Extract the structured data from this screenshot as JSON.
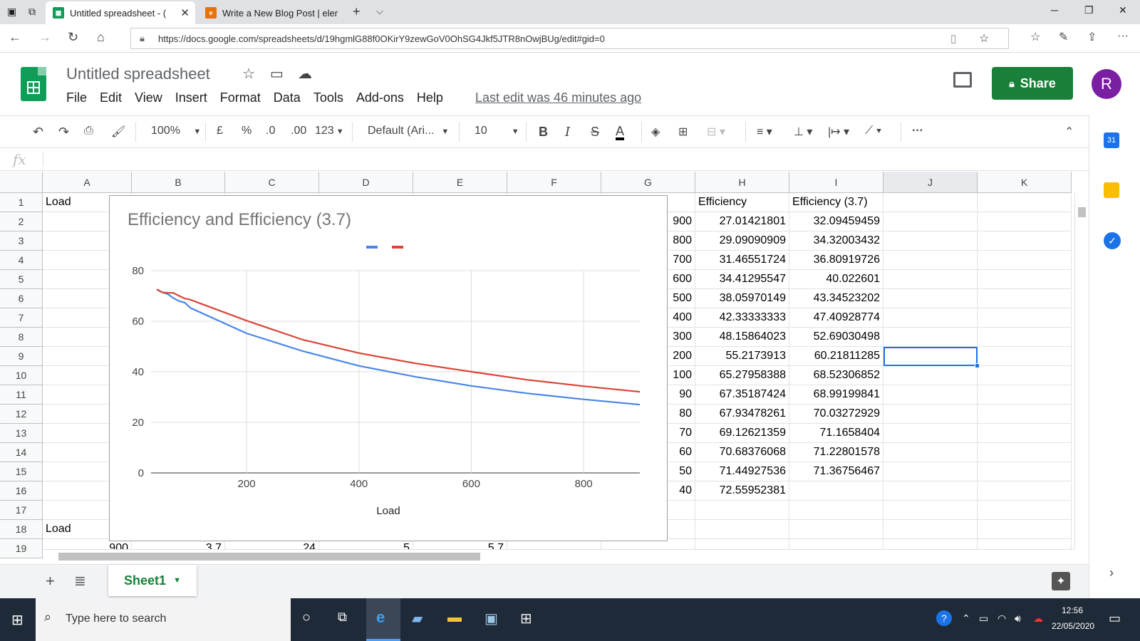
{
  "browser": {
    "tabs": [
      {
        "title": "Untitled spreadsheet - (",
        "active": true
      },
      {
        "title": "Write a New Blog Post | eler",
        "active": false
      }
    ],
    "url": "https://docs.google.com/spreadsheets/d/19hgmlG88f0OKirY9zewGoV0OhSG4Jkf5JTR8nOwjBUg/edit#gid=0"
  },
  "doc": {
    "title": "Untitled spreadsheet",
    "menu": [
      "File",
      "Edit",
      "View",
      "Insert",
      "Format",
      "Data",
      "Tools",
      "Add-ons",
      "Help"
    ],
    "last_edit": "Last edit was 46 minutes ago",
    "share_label": "Share",
    "avatar_letter": "R"
  },
  "toolbar": {
    "zoom": "100%",
    "currency": "£",
    "percent": "%",
    "dec_decrease": ".0",
    "dec_increase": ".00",
    "number_format": "123",
    "font": "Default (Ari...",
    "font_size": "10",
    "bold": "B",
    "italic": "I",
    "strike": "S",
    "text_color": "A",
    "more": "···"
  },
  "formula": {
    "fx": "fx"
  },
  "columns": [
    "A",
    "B",
    "C",
    "D",
    "E",
    "F",
    "G",
    "H",
    "I",
    "J",
    "K"
  ],
  "selected_column": "J",
  "rows": [
    "1",
    "2",
    "3",
    "4",
    "5",
    "6",
    "7",
    "8",
    "9",
    "10",
    "11",
    "12",
    "13",
    "14",
    "15",
    "16",
    "17",
    "18",
    "19"
  ],
  "cells": {
    "a1": "Load",
    "a18": "Load",
    "h1": "Efficiency",
    "i1": "Efficiency (3.7)",
    "g_values": [
      "900",
      "800",
      "700",
      "600",
      "500",
      "400",
      "300",
      "200",
      "100",
      "90",
      "80",
      "70",
      "60",
      "50",
      "40"
    ],
    "h_values": [
      "27.01421801",
      "29.09090909",
      "31.46551724",
      "34.41295547",
      "38.05970149",
      "42.33333333",
      "48.15864023",
      "55.2173913",
      "65.27958388",
      "67.35187424",
      "67.93478261",
      "69.12621359",
      "70.68376068",
      "71.44927536",
      "72.55952381"
    ],
    "i_values": [
      "32.09459459",
      "34.32003432",
      "36.80919726",
      "40.022601",
      "43.34523202",
      "47.40928774",
      "52.69030498",
      "60.21811285",
      "68.52306852",
      "68.99199841",
      "70.03272929",
      "71.1658404",
      "71.22801578",
      "71.36756467",
      ""
    ],
    "row19": [
      "900",
      "3.7",
      "24",
      "5",
      "5.7"
    ]
  },
  "sheet_tab": "Sheet1",
  "taskbar": {
    "search_placeholder": "Type here to search",
    "time": "12:56",
    "date": "22/05/2020"
  },
  "colors": {
    "series_blue": "#4a86e8",
    "series_red": "#db4437",
    "sheets_green": "#188038"
  },
  "chart_data": {
    "type": "line",
    "title": "Efficiency and Efficiency (3.7)",
    "xlabel": "Load",
    "ylabel": "",
    "xlim": [
      30,
      900
    ],
    "ylim": [
      0,
      80
    ],
    "x_ticks": [
      "200",
      "400",
      "600",
      "800"
    ],
    "y_ticks": [
      "0",
      "20",
      "40",
      "60",
      "80"
    ],
    "grid": true,
    "legend": "top-center",
    "x": [
      900,
      800,
      700,
      600,
      500,
      400,
      300,
      200,
      100,
      90,
      80,
      70,
      60,
      50,
      40
    ],
    "series": [
      {
        "color": "#4a86e8",
        "values": [
          27.01,
          29.09,
          31.47,
          34.41,
          38.06,
          42.33,
          48.16,
          55.22,
          65.28,
          67.35,
          67.93,
          69.13,
          70.68,
          71.45,
          72.56
        ]
      },
      {
        "color": "#db4437",
        "values": [
          32.09,
          34.32,
          36.81,
          40.02,
          43.35,
          47.41,
          52.69,
          60.22,
          68.52,
          68.99,
          70.03,
          71.17,
          71.23,
          71.37,
          72.6
        ]
      }
    ]
  }
}
